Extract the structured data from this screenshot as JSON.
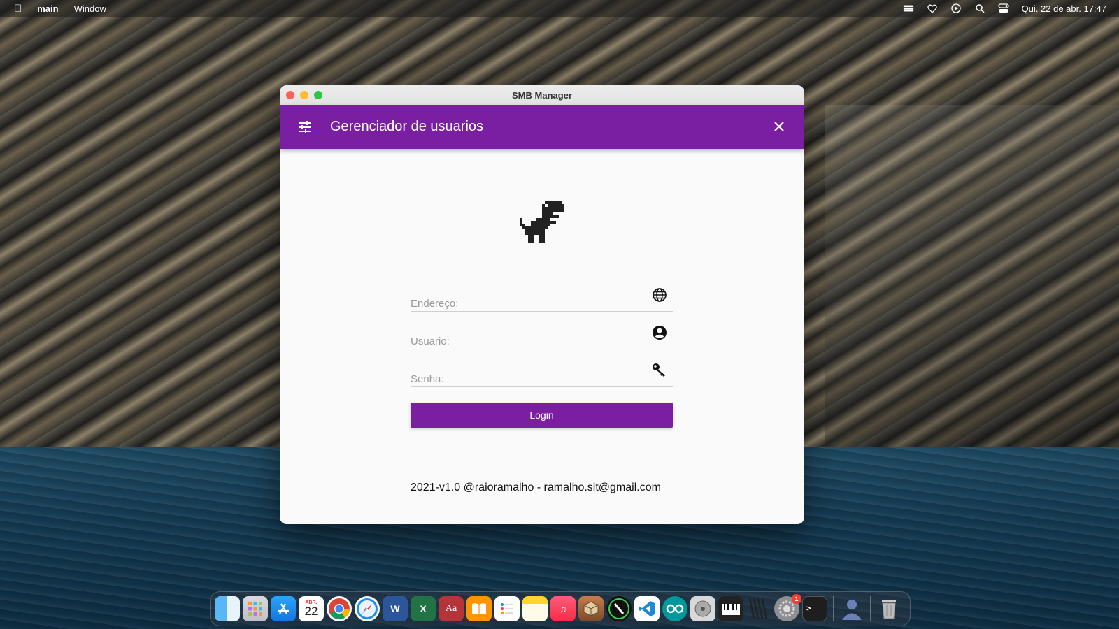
{
  "menubar": {
    "app_name": "main",
    "menu_window": "Window",
    "datetime": "Qui. 22 de abr.  17:47"
  },
  "window": {
    "title": "SMB Manager"
  },
  "appbar": {
    "title": "Gerenciador de usuarios",
    "accent_color": "#7b1fa2"
  },
  "form": {
    "address_label": "Endereço:",
    "user_label": "Usuario:",
    "password_label": "Senha:",
    "login_label": "Login"
  },
  "footer": {
    "text": "2021-v1.0 @raioramalho - ramalho.sit@gmail.com"
  },
  "dock": {
    "calendar_month": "ABR.",
    "calendar_day": "22",
    "settings_badge": "1",
    "apps": [
      "finder-icon",
      "launchpad-icon",
      "app-store-icon",
      "calendar-icon",
      "chrome-icon",
      "safari-icon",
      "word-icon",
      "excel-icon",
      "dictionary-icon",
      "books-icon",
      "reminders-icon",
      "notes-icon",
      "music-icon",
      "package-icon",
      "xcode-icon",
      "vscode-icon",
      "arduino-icon",
      "disk-utility-icon",
      "piano-icon",
      "barcode-icon",
      "system-preferences-icon",
      "terminal-icon",
      "user-icon",
      "trash-icon"
    ]
  }
}
